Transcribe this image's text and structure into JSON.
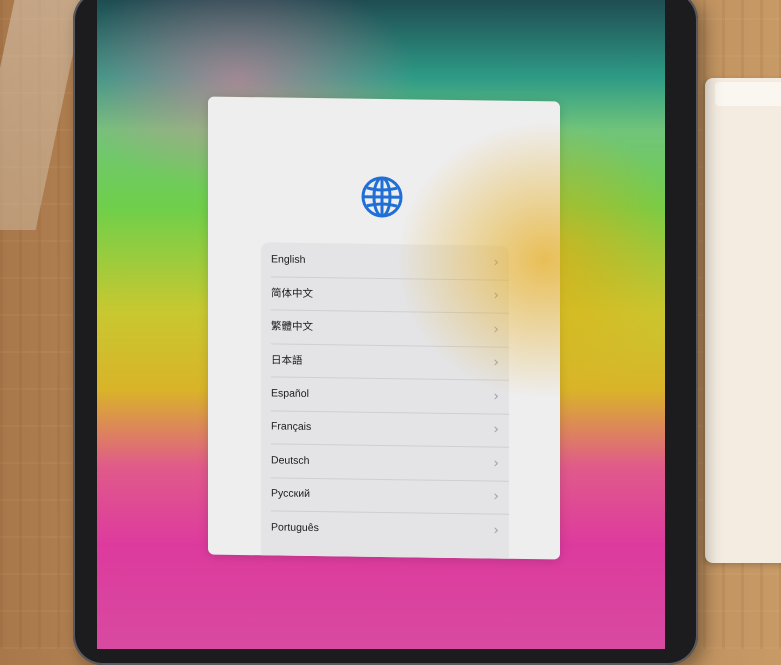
{
  "setup": {
    "icon": "globe-icon",
    "accent_color": "#1f6fd6",
    "languages": [
      {
        "label": "English"
      },
      {
        "label": "简体中文"
      },
      {
        "label": "繁體中文"
      },
      {
        "label": "日本語"
      },
      {
        "label": "Español"
      },
      {
        "label": "Français"
      },
      {
        "label": "Deutsch"
      },
      {
        "label": "Русский"
      },
      {
        "label": "Português"
      }
    ]
  }
}
